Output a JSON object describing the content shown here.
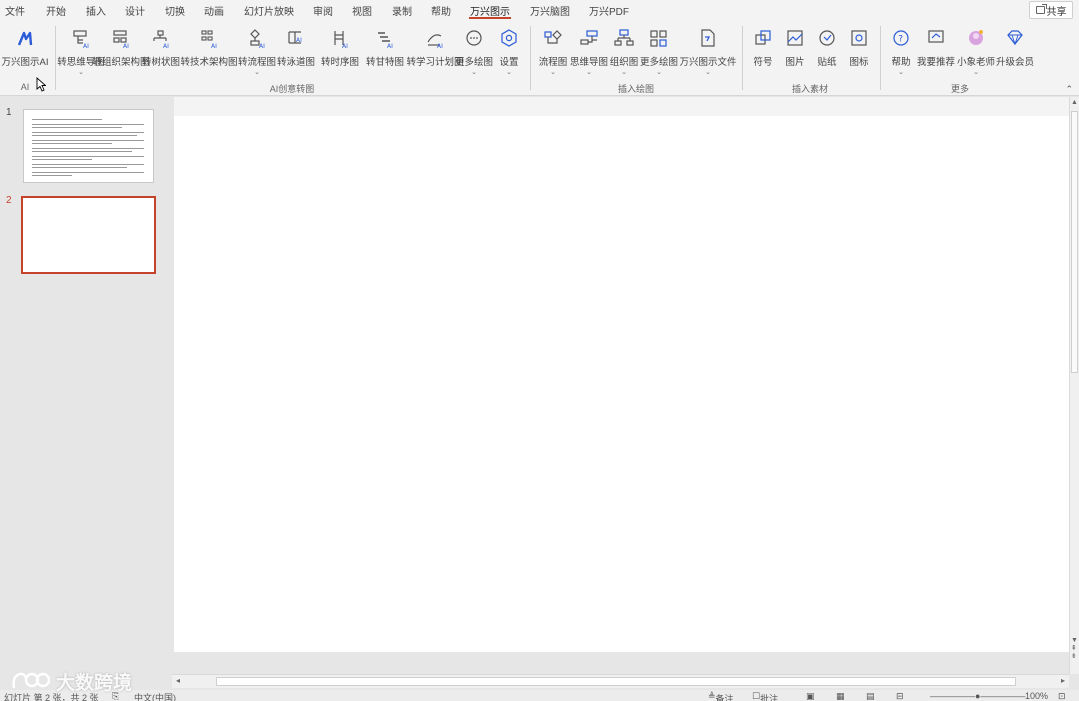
{
  "menu": {
    "tabs": [
      "文件",
      "开始",
      "插入",
      "设计",
      "切换",
      "动画",
      "幻灯片放映",
      "审阅",
      "视图",
      "录制",
      "帮助",
      "万兴图示",
      "万兴脑图",
      "万兴PDF"
    ],
    "active_index": 11,
    "share_label": "共享"
  },
  "ribbon": {
    "groups": [
      {
        "label": "AI",
        "buttons": [
          {
            "label": "万兴图示AI",
            "icon": "ai-logo-icon"
          }
        ]
      },
      {
        "label": "AI创意转图",
        "buttons": [
          {
            "label": "转思维导图",
            "icon": "mindmap-ai-icon",
            "dropdown": true
          },
          {
            "label": "转组织架构图",
            "icon": "org-chart-ai-icon"
          },
          {
            "label": "转树状图",
            "icon": "tree-ai-icon"
          },
          {
            "label": "转技术架构图",
            "icon": "tech-arch-ai-icon"
          },
          {
            "label": "转流程图",
            "icon": "flowchart-ai-icon",
            "dropdown": true
          },
          {
            "label": "转泳道图",
            "icon": "swimlane-ai-icon"
          },
          {
            "label": "转时序图",
            "icon": "sequence-ai-icon"
          },
          {
            "label": "转甘特图",
            "icon": "gantt-ai-icon"
          },
          {
            "label": "转学习计划图",
            "icon": "study-plan-ai-icon"
          },
          {
            "label": "更多绘图",
            "icon": "more-drawing-icon",
            "dropdown": true
          },
          {
            "label": "设置",
            "icon": "settings-icon",
            "dropdown": true
          }
        ]
      },
      {
        "label": "插入绘图",
        "buttons": [
          {
            "label": "流程图",
            "icon": "flowchart-icon",
            "dropdown": true
          },
          {
            "label": "思维导图",
            "icon": "mindmap-icon",
            "dropdown": true
          },
          {
            "label": "组织图",
            "icon": "org-chart-icon",
            "dropdown": true
          },
          {
            "label": "更多绘图",
            "icon": "more-drawings-icon",
            "dropdown": true
          },
          {
            "label": "万兴图示文件",
            "icon": "edraw-file-icon",
            "dropdown": true
          }
        ]
      },
      {
        "label": "插入素材",
        "buttons": [
          {
            "label": "符号",
            "icon": "symbol-icon"
          },
          {
            "label": "图片",
            "icon": "picture-icon"
          },
          {
            "label": "贴纸",
            "icon": "sticker-icon"
          },
          {
            "label": "图标",
            "icon": "icon-library-icon"
          }
        ]
      },
      {
        "label": "更多",
        "buttons": [
          {
            "label": "帮助",
            "icon": "help-icon",
            "dropdown": true
          },
          {
            "label": "我要推荐",
            "icon": "recommend-icon"
          },
          {
            "label": "小象老师",
            "icon": "teacher-avatar-icon",
            "dropdown": true
          },
          {
            "label": "升级会员",
            "icon": "diamond-icon"
          }
        ]
      }
    ]
  },
  "slides": [
    {
      "number": "1",
      "has_content": true
    },
    {
      "number": "2",
      "has_content": false,
      "selected": true
    }
  ],
  "status": {
    "slide_info": "幻灯片 第 2 张，共 2 张",
    "language": "中文(中国)",
    "notes": "备注",
    "comments": "批注",
    "zoom": "100%"
  },
  "watermark": "大数跨境",
  "colors": {
    "accent": "#c4432a",
    "ribbon_bg": "#f3f3f3",
    "workspace_bg": "#e6e6e6"
  }
}
